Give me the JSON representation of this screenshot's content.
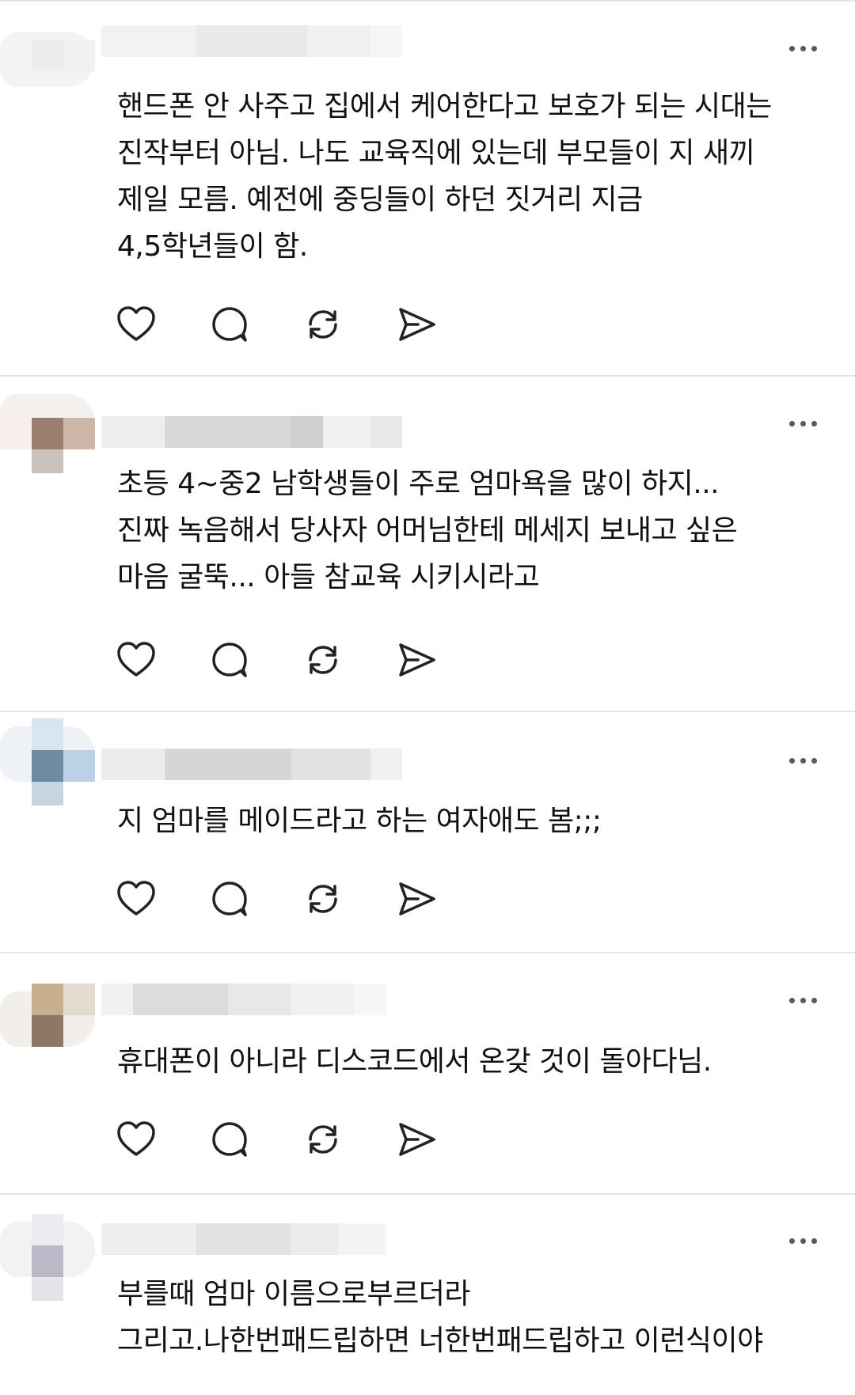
{
  "posts": [
    {
      "text": "핸드폰 안 사주고 집에서 케어한다고 보호가 되는 시대는\n진작부터 아님. 나도 교육직에 있는데 부모들이 지 새끼\n제일 모름. 예전에 중딩들이 하던 짓거리 지금\n4,5학년들이 함."
    },
    {
      "text": "초등 4~중2 남학생들이 주로 엄마욕을 많이 하지...\n진짜 녹음해서 당사자 어머님한테 메세지 보내고 싶은\n마음 굴뚝... 아들 참교육 시키시라고"
    },
    {
      "text": "지 엄마를 메이드라고 하는 여자애도 봄;;;"
    },
    {
      "text": "휴대폰이 아니라 디스코드에서 온갖 것이 돌아다님."
    },
    {
      "text": "부를때 엄마 이름으로부르더라\n그리고.나한번패드립하면 너한번패드립하고 이런식이야"
    }
  ],
  "icons": {
    "like": "heart-icon",
    "reply": "comment-bubble-icon",
    "repost": "repost-icon",
    "share": "send-icon",
    "more": "more-dots-icon"
  },
  "colors": {
    "text": "#111111",
    "icon": "#222222",
    "divider": "#e6e6e6",
    "more_dots": "#5a5a5a"
  }
}
